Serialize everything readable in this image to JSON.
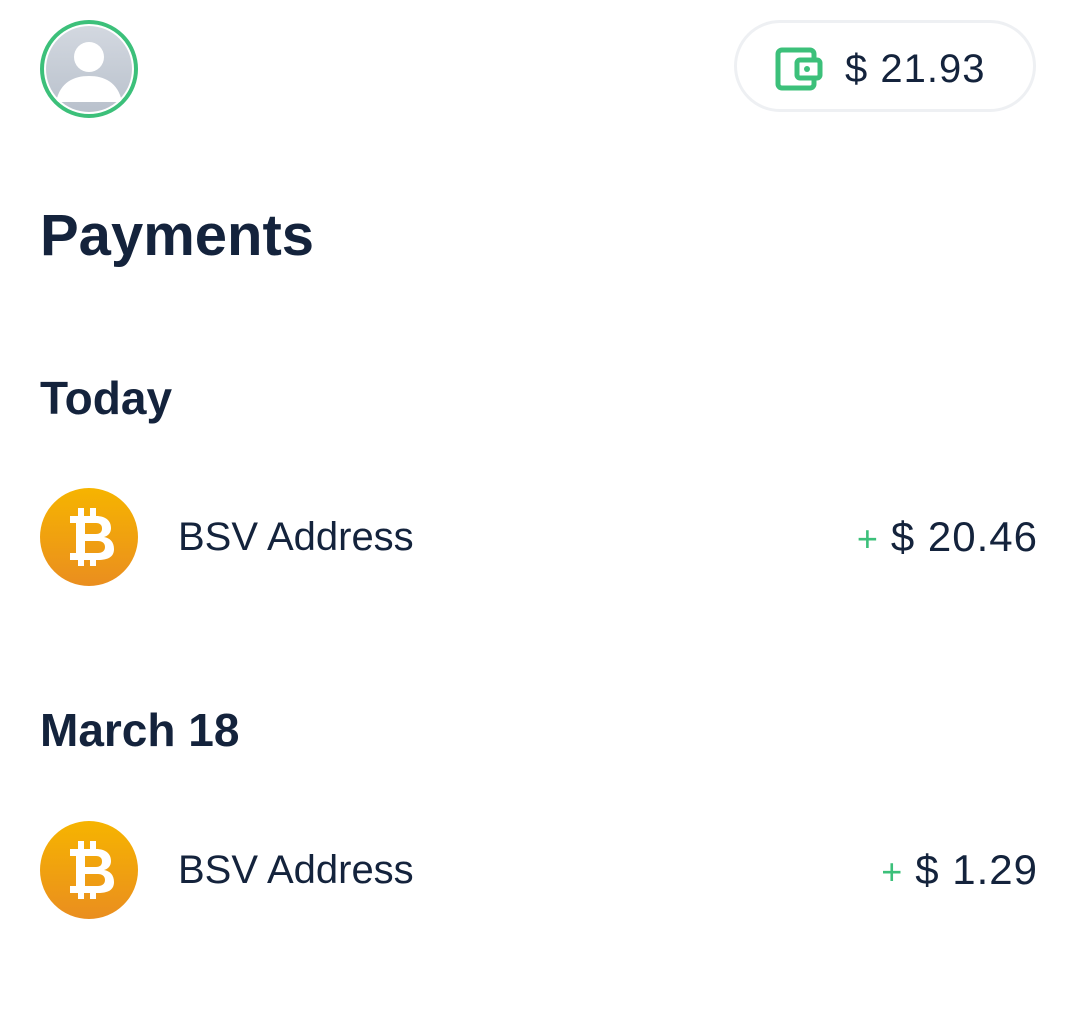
{
  "header": {
    "avatar_icon": "user-avatar-icon",
    "wallet_icon": "wallet-icon",
    "balance": "$ 21.93"
  },
  "page": {
    "title": "Payments"
  },
  "sections": [
    {
      "heading": "Today",
      "payments": [
        {
          "icon": "bitcoin-icon",
          "label": "BSV Address",
          "sign": "+",
          "amount": "$ 20.46"
        }
      ]
    },
    {
      "heading": "March 18",
      "payments": [
        {
          "icon": "bitcoin-icon",
          "label": "BSV Address",
          "sign": "+",
          "amount": "$ 1.29"
        }
      ]
    }
  ],
  "colors": {
    "accent_green": "#3cc07a",
    "text_dark": "#14233c",
    "coin_orange": "#f0a500",
    "pill_border": "#eef0f3"
  }
}
